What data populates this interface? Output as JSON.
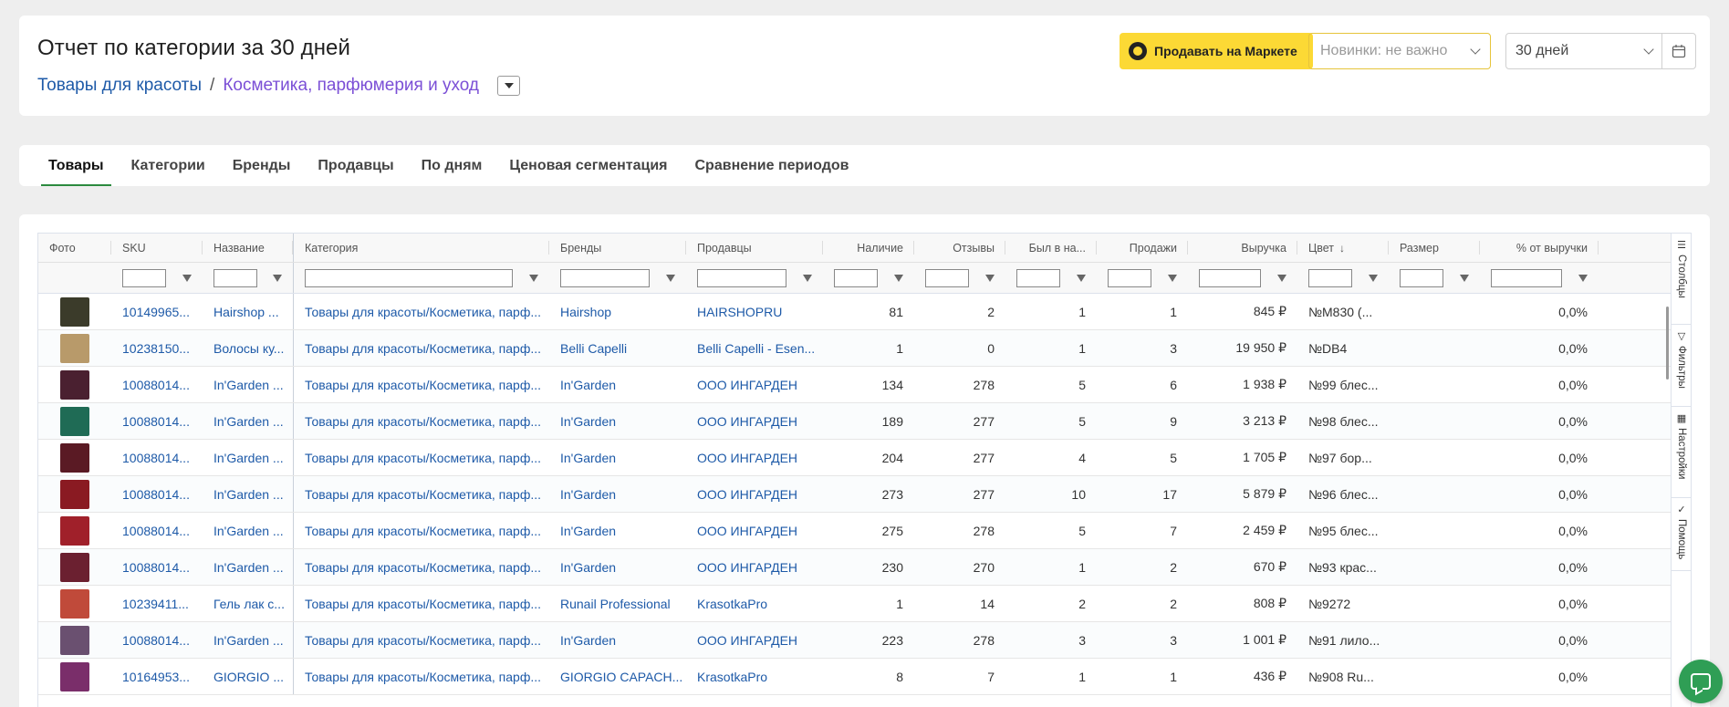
{
  "header": {
    "title": "Отчет по категории за 30 дней",
    "breadcrumb": [
      "Товары для красоты",
      "Косметика, парфюмерия и уход"
    ],
    "breadcrumb_sep": "/",
    "sell_button": "Продавать на Маркете",
    "new_filter_placeholder": "Новинки: не важно",
    "period_value": "30 дней"
  },
  "tabs": [
    "Товары",
    "Категории",
    "Бренды",
    "Продавцы",
    "По дням",
    "Ценовая сегментация",
    "Сравнение периодов"
  ],
  "table": {
    "columns": [
      "Фото",
      "SKU",
      "Название",
      "Категория",
      "Бренды",
      "Продавцы",
      "Наличие",
      "Отзывы",
      "Был в на...",
      "Продажи",
      "Выручка",
      "Цвет",
      "Размер",
      "% от выручки"
    ],
    "sort_arrow": "↓",
    "rows": [
      {
        "sku": "10149965...",
        "name": "Hairshop ...",
        "category": "Товары для красоты/Косметика, парф...",
        "brand": "Hairshop",
        "seller": "HAIRSHOPRU",
        "stock": "81",
        "reviews": "2",
        "in_stock": "1",
        "sales": "1",
        "revenue": "845 ₽",
        "color": "№M830 (...",
        "size": "",
        "pct": "0,0%",
        "thumb": "#3b3b2a"
      },
      {
        "sku": "10238150...",
        "name": "Волосы ку...",
        "category": "Товары для красоты/Косметика, парф...",
        "brand": "Belli Capelli",
        "seller": "Belli Capelli - Esen...",
        "stock": "1",
        "reviews": "0",
        "in_stock": "1",
        "sales": "3",
        "revenue": "19 950 ₽",
        "color": "№DB4",
        "size": "",
        "pct": "0,0%",
        "thumb": "#b89a6a"
      },
      {
        "sku": "10088014...",
        "name": "In'Garden ...",
        "category": "Товары для красоты/Косметика, парф...",
        "brand": "In'Garden",
        "seller": "ООО ИНГАРДЕН",
        "stock": "134",
        "reviews": "278",
        "in_stock": "5",
        "sales": "6",
        "revenue": "1 938 ₽",
        "color": "№99 блес...",
        "size": "",
        "pct": "0,0%",
        "thumb": "#4a2030"
      },
      {
        "sku": "10088014...",
        "name": "In'Garden ...",
        "category": "Товары для красоты/Косметика, парф...",
        "brand": "In'Garden",
        "seller": "ООО ИНГАРДЕН",
        "stock": "189",
        "reviews": "277",
        "in_stock": "5",
        "sales": "9",
        "revenue": "3 213 ₽",
        "color": "№98 блес...",
        "size": "",
        "pct": "0,0%",
        "thumb": "#1f6b55"
      },
      {
        "sku": "10088014...",
        "name": "In'Garden ...",
        "category": "Товары для красоты/Косметика, парф...",
        "brand": "In'Garden",
        "seller": "ООО ИНГАРДЕН",
        "stock": "204",
        "reviews": "277",
        "in_stock": "4",
        "sales": "5",
        "revenue": "1 705 ₽",
        "color": "№97 бор...",
        "size": "",
        "pct": "0,0%",
        "thumb": "#5a1a24"
      },
      {
        "sku": "10088014...",
        "name": "In'Garden ...",
        "category": "Товары для красоты/Косметика, парф...",
        "brand": "In'Garden",
        "seller": "ООО ИНГАРДЕН",
        "stock": "273",
        "reviews": "277",
        "in_stock": "10",
        "sales": "17",
        "revenue": "5 879 ₽",
        "color": "№96 блес...",
        "size": "",
        "pct": "0,0%",
        "thumb": "#8a1a22"
      },
      {
        "sku": "10088014...",
        "name": "In'Garden ...",
        "category": "Товары для красоты/Косметика, парф...",
        "brand": "In'Garden",
        "seller": "ООО ИНГАРДЕН",
        "stock": "275",
        "reviews": "278",
        "in_stock": "5",
        "sales": "7",
        "revenue": "2 459 ₽",
        "color": "№95 блес...",
        "size": "",
        "pct": "0,0%",
        "thumb": "#a0202a"
      },
      {
        "sku": "10088014...",
        "name": "In'Garden ...",
        "category": "Товары для красоты/Косметика, парф...",
        "brand": "In'Garden",
        "seller": "ООО ИНГАРДЕН",
        "stock": "230",
        "reviews": "270",
        "in_stock": "1",
        "sales": "2",
        "revenue": "670 ₽",
        "color": "№93 крас...",
        "size": "",
        "pct": "0,0%",
        "thumb": "#6b2030"
      },
      {
        "sku": "10239411...",
        "name": "Гель лак с...",
        "category": "Товары для красоты/Косметика, парф...",
        "brand": "Runail Professional",
        "seller": "KrasotkaPro",
        "stock": "1",
        "reviews": "14",
        "in_stock": "2",
        "sales": "2",
        "revenue": "808 ₽",
        "color": "№9272",
        "size": "",
        "pct": "0,0%",
        "thumb": "#c04a3a"
      },
      {
        "sku": "10088014...",
        "name": "In'Garden ...",
        "category": "Товары для красоты/Косметика, парф...",
        "brand": "In'Garden",
        "seller": "ООО ИНГАРДЕН",
        "stock": "223",
        "reviews": "278",
        "in_stock": "3",
        "sales": "3",
        "revenue": "1 001 ₽",
        "color": "№91 лило...",
        "size": "",
        "pct": "0,0%",
        "thumb": "#6a5070"
      },
      {
        "sku": "10164953...",
        "name": "GIORGIO ...",
        "category": "Товары для красоты/Косметика, парф...",
        "brand": "GIORGIO CAPACH...",
        "seller": "KrasotkaPro",
        "stock": "8",
        "reviews": "7",
        "in_stock": "1",
        "sales": "1",
        "revenue": "436 ₽",
        "color": "№908 Ru...",
        "size": "",
        "pct": "0,0%",
        "thumb": "#7a2e6a"
      }
    ]
  },
  "side_panel": [
    "Столбцы",
    "Фильтры",
    "Настройки",
    "Помощь"
  ],
  "colors": {
    "accent_green": "#2b8a3e",
    "link_blue": "#1e5aa8",
    "crumb_purple": "#7b4fd6",
    "market_yellow": "#fcd935"
  }
}
